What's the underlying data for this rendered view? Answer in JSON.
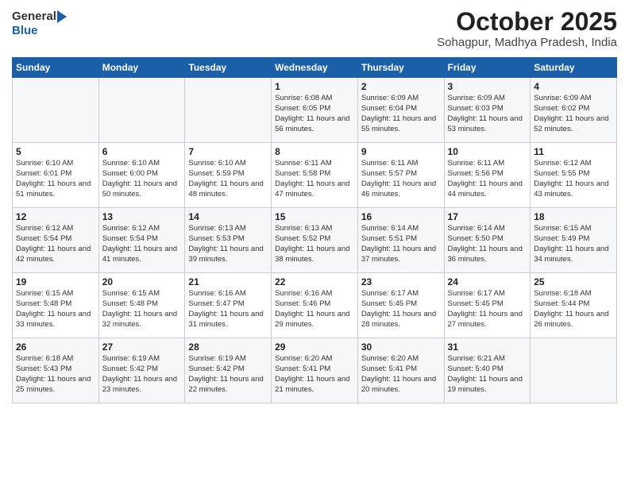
{
  "header": {
    "logo_general": "General",
    "logo_blue": "Blue",
    "title": "October 2025",
    "location": "Sohagpur, Madhya Pradesh, India"
  },
  "days_of_week": [
    "Sunday",
    "Monday",
    "Tuesday",
    "Wednesday",
    "Thursday",
    "Friday",
    "Saturday"
  ],
  "weeks": [
    [
      {
        "day": "",
        "text": ""
      },
      {
        "day": "",
        "text": ""
      },
      {
        "day": "",
        "text": ""
      },
      {
        "day": "1",
        "text": "Sunrise: 6:08 AM\nSunset: 6:05 PM\nDaylight: 11 hours\nand 56 minutes."
      },
      {
        "day": "2",
        "text": "Sunrise: 6:09 AM\nSunset: 6:04 PM\nDaylight: 11 hours\nand 55 minutes."
      },
      {
        "day": "3",
        "text": "Sunrise: 6:09 AM\nSunset: 6:03 PM\nDaylight: 11 hours\nand 53 minutes."
      },
      {
        "day": "4",
        "text": "Sunrise: 6:09 AM\nSunset: 6:02 PM\nDaylight: 11 hours\nand 52 minutes."
      }
    ],
    [
      {
        "day": "5",
        "text": "Sunrise: 6:10 AM\nSunset: 6:01 PM\nDaylight: 11 hours\nand 51 minutes."
      },
      {
        "day": "6",
        "text": "Sunrise: 6:10 AM\nSunset: 6:00 PM\nDaylight: 11 hours\nand 50 minutes."
      },
      {
        "day": "7",
        "text": "Sunrise: 6:10 AM\nSunset: 5:59 PM\nDaylight: 11 hours\nand 48 minutes."
      },
      {
        "day": "8",
        "text": "Sunrise: 6:11 AM\nSunset: 5:58 PM\nDaylight: 11 hours\nand 47 minutes."
      },
      {
        "day": "9",
        "text": "Sunrise: 6:11 AM\nSunset: 5:57 PM\nDaylight: 11 hours\nand 46 minutes."
      },
      {
        "day": "10",
        "text": "Sunrise: 6:11 AM\nSunset: 5:56 PM\nDaylight: 11 hours\nand 44 minutes."
      },
      {
        "day": "11",
        "text": "Sunrise: 6:12 AM\nSunset: 5:55 PM\nDaylight: 11 hours\nand 43 minutes."
      }
    ],
    [
      {
        "day": "12",
        "text": "Sunrise: 6:12 AM\nSunset: 5:54 PM\nDaylight: 11 hours\nand 42 minutes."
      },
      {
        "day": "13",
        "text": "Sunrise: 6:12 AM\nSunset: 5:54 PM\nDaylight: 11 hours\nand 41 minutes."
      },
      {
        "day": "14",
        "text": "Sunrise: 6:13 AM\nSunset: 5:53 PM\nDaylight: 11 hours\nand 39 minutes."
      },
      {
        "day": "15",
        "text": "Sunrise: 6:13 AM\nSunset: 5:52 PM\nDaylight: 11 hours\nand 38 minutes."
      },
      {
        "day": "16",
        "text": "Sunrise: 6:14 AM\nSunset: 5:51 PM\nDaylight: 11 hours\nand 37 minutes."
      },
      {
        "day": "17",
        "text": "Sunrise: 6:14 AM\nSunset: 5:50 PM\nDaylight: 11 hours\nand 36 minutes."
      },
      {
        "day": "18",
        "text": "Sunrise: 6:15 AM\nSunset: 5:49 PM\nDaylight: 11 hours\nand 34 minutes."
      }
    ],
    [
      {
        "day": "19",
        "text": "Sunrise: 6:15 AM\nSunset: 5:48 PM\nDaylight: 11 hours\nand 33 minutes."
      },
      {
        "day": "20",
        "text": "Sunrise: 6:15 AM\nSunset: 5:48 PM\nDaylight: 11 hours\nand 32 minutes."
      },
      {
        "day": "21",
        "text": "Sunrise: 6:16 AM\nSunset: 5:47 PM\nDaylight: 11 hours\nand 31 minutes."
      },
      {
        "day": "22",
        "text": "Sunrise: 6:16 AM\nSunset: 5:46 PM\nDaylight: 11 hours\nand 29 minutes."
      },
      {
        "day": "23",
        "text": "Sunrise: 6:17 AM\nSunset: 5:45 PM\nDaylight: 11 hours\nand 28 minutes."
      },
      {
        "day": "24",
        "text": "Sunrise: 6:17 AM\nSunset: 5:45 PM\nDaylight: 11 hours\nand 27 minutes."
      },
      {
        "day": "25",
        "text": "Sunrise: 6:18 AM\nSunset: 5:44 PM\nDaylight: 11 hours\nand 26 minutes."
      }
    ],
    [
      {
        "day": "26",
        "text": "Sunrise: 6:18 AM\nSunset: 5:43 PM\nDaylight: 11 hours\nand 25 minutes."
      },
      {
        "day": "27",
        "text": "Sunrise: 6:19 AM\nSunset: 5:42 PM\nDaylight: 11 hours\nand 23 minutes."
      },
      {
        "day": "28",
        "text": "Sunrise: 6:19 AM\nSunset: 5:42 PM\nDaylight: 11 hours\nand 22 minutes."
      },
      {
        "day": "29",
        "text": "Sunrise: 6:20 AM\nSunset: 5:41 PM\nDaylight: 11 hours\nand 21 minutes."
      },
      {
        "day": "30",
        "text": "Sunrise: 6:20 AM\nSunset: 5:41 PM\nDaylight: 11 hours\nand 20 minutes."
      },
      {
        "day": "31",
        "text": "Sunrise: 6:21 AM\nSunset: 5:40 PM\nDaylight: 11 hours\nand 19 minutes."
      },
      {
        "day": "",
        "text": ""
      }
    ]
  ]
}
